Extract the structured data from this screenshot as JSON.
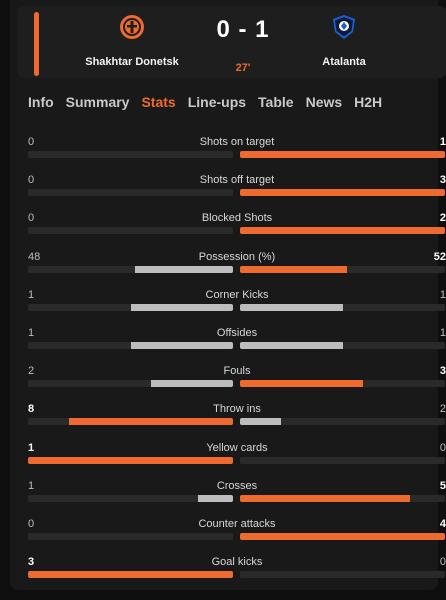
{
  "match": {
    "home_team": "Shakhtar Donetsk",
    "away_team": "Atalanta",
    "score": "0 - 1",
    "minute": "27'"
  },
  "tabs": [
    "Info",
    "Summary",
    "Stats",
    "Line-ups",
    "Table",
    "News",
    "H2H"
  ],
  "active_tab": "Stats",
  "stats": [
    {
      "label": "Shots on target",
      "home": "0",
      "away": "1",
      "home_share": 0,
      "away_share": 1
    },
    {
      "label": "Shots off target",
      "home": "0",
      "away": "3",
      "home_share": 0,
      "away_share": 1
    },
    {
      "label": "Blocked Shots",
      "home": "0",
      "away": "2",
      "home_share": 0,
      "away_share": 1
    },
    {
      "label": "Possession (%)",
      "home": "48",
      "away": "52",
      "home_share": 0.48,
      "away_share": 0.52
    },
    {
      "label": "Corner Kicks",
      "home": "1",
      "away": "1",
      "home_share": 0.5,
      "away_share": 0.5
    },
    {
      "label": "Offsides",
      "home": "1",
      "away": "1",
      "home_share": 0.5,
      "away_share": 0.5
    },
    {
      "label": "Fouls",
      "home": "2",
      "away": "3",
      "home_share": 0.4,
      "away_share": 0.6
    },
    {
      "label": "Throw ins",
      "home": "8",
      "away": "2",
      "home_share": 0.8,
      "away_share": 0.2
    },
    {
      "label": "Yellow cards",
      "home": "1",
      "away": "0",
      "home_share": 1,
      "away_share": 0
    },
    {
      "label": "Crosses",
      "home": "1",
      "away": "5",
      "home_share": 0.17,
      "away_share": 0.83
    },
    {
      "label": "Counter attacks",
      "home": "0",
      "away": "4",
      "home_share": 0,
      "away_share": 1
    },
    {
      "label": "Goal kicks",
      "home": "3",
      "away": "0",
      "home_share": 1,
      "away_share": 0
    }
  ],
  "colors": {
    "accent": "#ef6a2e",
    "neutral_bar": "#bdbdbd",
    "track": "#2a2a2a"
  },
  "icons": {
    "home_crest": "shakhtar-crest-icon",
    "away_crest": "atalanta-crest-icon"
  }
}
